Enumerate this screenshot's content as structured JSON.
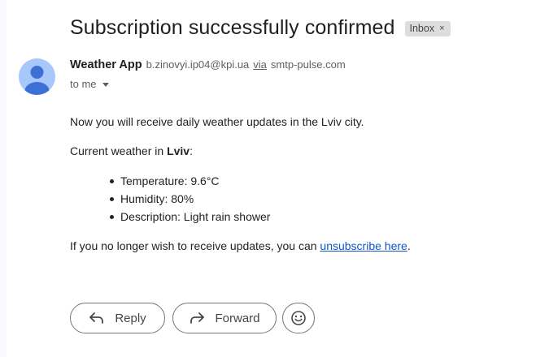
{
  "subject": "Subscription successfully confirmed",
  "label": {
    "text": "Inbox",
    "remove_glyph": "×"
  },
  "sender": {
    "name": "Weather App",
    "email": "b.zinovyi.ip04@kpi.ua",
    "via_word": "via",
    "via_host": "smtp-pulse.com"
  },
  "recipient": "to me",
  "body": {
    "line1": "Now you will receive daily weather updates in the Lviv city.",
    "current_prefix": "Current weather in ",
    "city": "Lviv",
    "current_suffix": ":",
    "items": [
      "Temperature: 9.6°C",
      "Humidity: 80%",
      "Description: Light rain shower"
    ],
    "unsubscribe_prefix": "If you no longer wish to receive updates, you can ",
    "unsubscribe_link": "unsubscribe here",
    "unsubscribe_suffix": "."
  },
  "actions": {
    "reply": "Reply",
    "forward": "Forward"
  },
  "icons": {
    "avatar": "person-icon",
    "reply": "reply-arrow-icon",
    "forward": "forward-arrow-icon",
    "emoji": "emoji-smile-icon",
    "dropdown": "caret-down-icon"
  },
  "colors": {
    "avatar_bg": "#a8c7fa",
    "avatar_figure": "#3c70d4",
    "link": "#1155cc",
    "chip_bg": "#dddddd"
  }
}
